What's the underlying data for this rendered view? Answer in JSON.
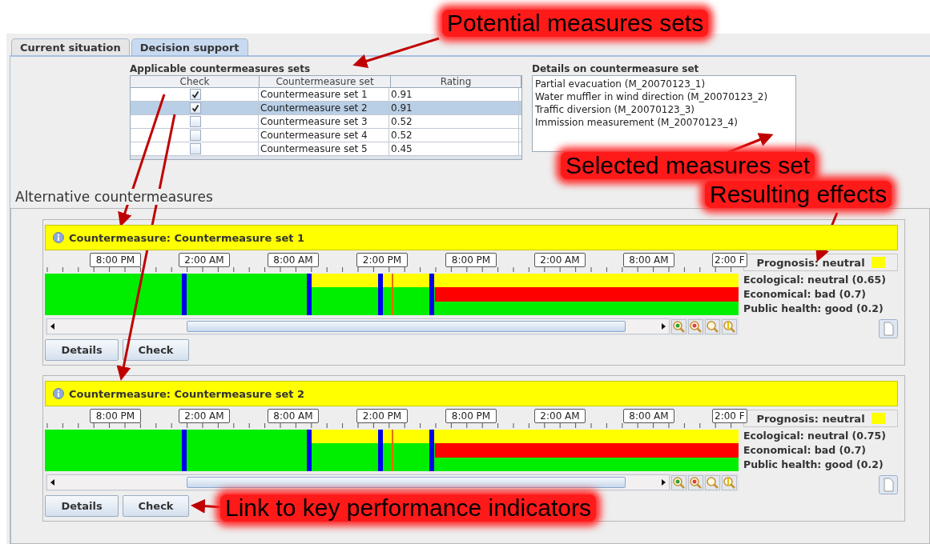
{
  "tabs": [
    {
      "label": "Current situation",
      "selected": false
    },
    {
      "label": "Decision support",
      "selected": true
    }
  ],
  "sets_table": {
    "title": "Applicable countermeasures sets",
    "columns": [
      "Check",
      "Countermeasure set",
      "Rating"
    ],
    "rows": [
      {
        "checked": true,
        "selected": false,
        "name": "Countermeasure set 1",
        "rating": "0.91"
      },
      {
        "checked": true,
        "selected": true,
        "name": "Countermeasure set 2",
        "rating": "0.91"
      },
      {
        "checked": false,
        "selected": false,
        "name": "Countermeasure set 3",
        "rating": "0.52"
      },
      {
        "checked": false,
        "selected": false,
        "name": "Countermeasure set 4",
        "rating": "0.52"
      },
      {
        "checked": false,
        "selected": false,
        "name": "Countermeasure set 5",
        "rating": "0.45"
      }
    ]
  },
  "details": {
    "title": "Details on countermeasure set",
    "items": [
      "Partial evacuation (M_20070123_1)",
      "Water muffler in wind direction (M_20070123_2)",
      "Traffic diversion (M_20070123_3)",
      "Immission measurement (M_20070123_4)"
    ]
  },
  "alternatives": {
    "title": "Alternative countermeasures",
    "panels": [
      {
        "title": "Countermeasure: Countermeasure set 1",
        "time_labels": [
          "8:00 PM",
          "2:00 AM",
          "8:00 AM",
          "2:00 PM",
          "8:00 PM",
          "2:00 AM",
          "8:00 AM",
          "2:00 F"
        ],
        "prognosis": {
          "label": "Prognosis: neutral",
          "color": "#ffff00"
        },
        "effects": [
          "Ecological: neutral (0.65)",
          "Economical: bad (0.7)",
          "Public health: good (0.2)"
        ],
        "buttons": [
          "Details",
          "Check"
        ]
      },
      {
        "title": "Countermeasure: Countermeasure set 2",
        "time_labels": [
          "8:00 PM",
          "2:00 AM",
          "8:00 AM",
          "2:00 PM",
          "8:00 PM",
          "2:00 AM",
          "8:00 AM",
          "2:00 F"
        ],
        "prognosis": {
          "label": "Prognosis: neutral",
          "color": "#ffff00"
        },
        "effects": [
          "Ecological: neutral (0.75)",
          "Economical: bad (0.7)",
          "Public health: good (0.2)"
        ],
        "buttons": [
          "Details",
          "Check"
        ]
      }
    ]
  },
  "annotations": [
    {
      "kind": "potential",
      "text": "Potential measures sets"
    },
    {
      "kind": "selected",
      "text": "Selected measures set"
    },
    {
      "kind": "effects",
      "text": "Resulting effects"
    },
    {
      "kind": "link",
      "text": "Link to key performance indicators"
    }
  ]
}
